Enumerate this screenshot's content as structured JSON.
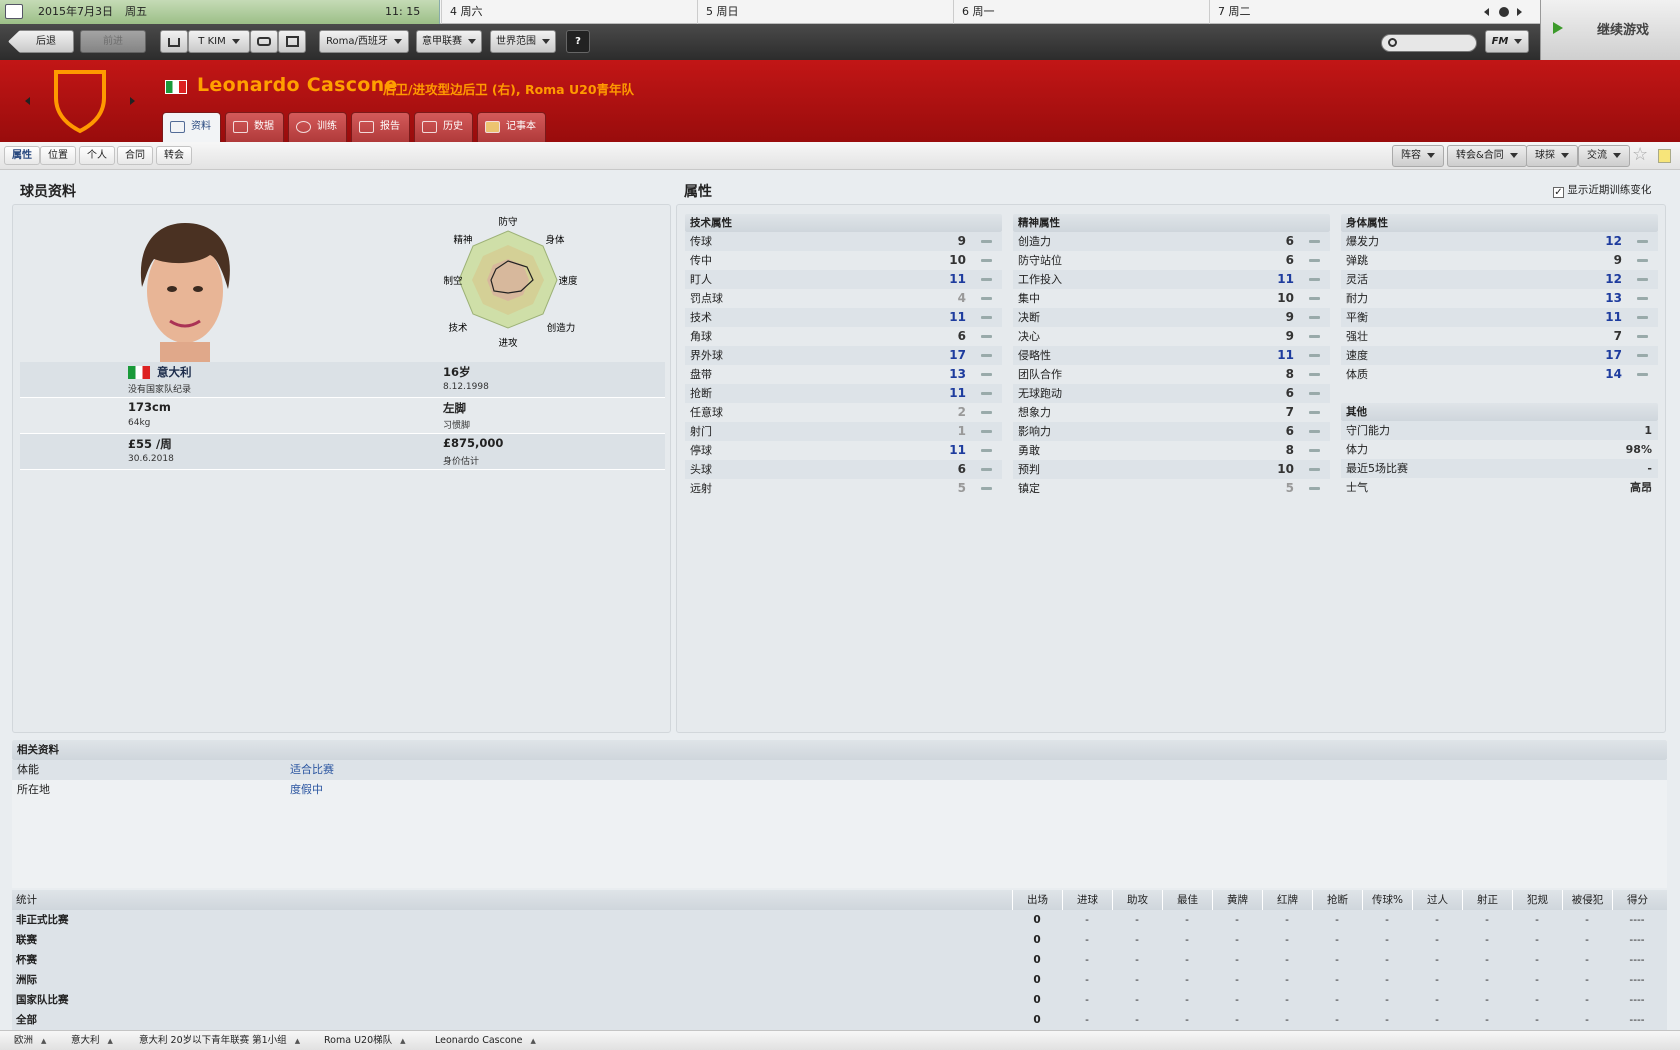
{
  "calendar": {
    "date": "2015年7月3日",
    "weekday": "周五",
    "time": "11: 15",
    "days": [
      "4 周六",
      "5 周日",
      "6 周一",
      "7 周二"
    ]
  },
  "nav": {
    "back": "后退",
    "forward": "前进",
    "manager": "T KIM",
    "team": "Roma/西班牙",
    "league": "意甲联赛",
    "world": "世界范围",
    "help": "?",
    "fm": "FM",
    "continue": "继续游戏"
  },
  "player": {
    "name": "Leonardo Cascone",
    "position": "后卫/进攻型边后卫 (右), Roma U20青年队"
  },
  "tabs": [
    "资料",
    "数据",
    "训练",
    "报告",
    "历史",
    "记事本"
  ],
  "subtabs": [
    "属性",
    "位置",
    "个人",
    "合同",
    "转会"
  ],
  "right_actions": [
    "阵容",
    "转会&合同",
    "球探",
    "交流"
  ],
  "profile": {
    "title": "球员资料",
    "radar_labels": [
      "防守",
      "身体",
      "速度",
      "创造力",
      "进攻",
      "技术",
      "制空",
      "精神"
    ],
    "nation": "意大利",
    "caps": "没有国家队纪录",
    "age": "16岁",
    "dob": "8.12.1998",
    "height": "173cm",
    "weight": "64kg",
    "foot": "左脚",
    "foot_label": "习惯脚",
    "wage": "£55 /周",
    "contract": "30.6.2018",
    "value": "£875,000",
    "value_label": "身价估计"
  },
  "attributes": {
    "title": "属性",
    "show_training": "显示近期训练变化",
    "technical": {
      "title": "技术属性",
      "rows": [
        [
          "传球",
          "9"
        ],
        [
          "传中",
          "10"
        ],
        [
          "盯人",
          "11"
        ],
        [
          "罚点球",
          "4"
        ],
        [
          "技术",
          "11"
        ],
        [
          "角球",
          "6"
        ],
        [
          "界外球",
          "17"
        ],
        [
          "盘带",
          "13"
        ],
        [
          "抢断",
          "11"
        ],
        [
          "任意球",
          "2"
        ],
        [
          "射门",
          "1"
        ],
        [
          "停球",
          "11"
        ],
        [
          "头球",
          "6"
        ],
        [
          "远射",
          "5"
        ]
      ]
    },
    "mental": {
      "title": "精神属性",
      "rows": [
        [
          "创造力",
          "6"
        ],
        [
          "防守站位",
          "6"
        ],
        [
          "工作投入",
          "11"
        ],
        [
          "集中",
          "10"
        ],
        [
          "决断",
          "9"
        ],
        [
          "决心",
          "9"
        ],
        [
          "侵略性",
          "11"
        ],
        [
          "团队合作",
          "8"
        ],
        [
          "无球跑动",
          "6"
        ],
        [
          "想象力",
          "7"
        ],
        [
          "影响力",
          "6"
        ],
        [
          "勇敢",
          "8"
        ],
        [
          "预判",
          "10"
        ],
        [
          "镇定",
          "5"
        ]
      ]
    },
    "physical": {
      "title": "身体属性",
      "rows": [
        [
          "爆发力",
          "12"
        ],
        [
          "弹跳",
          "9"
        ],
        [
          "灵活",
          "12"
        ],
        [
          "耐力",
          "13"
        ],
        [
          "平衡",
          "11"
        ],
        [
          "强壮",
          "7"
        ],
        [
          "速度",
          "17"
        ],
        [
          "体质",
          "14"
        ]
      ]
    },
    "other": {
      "title": "其他",
      "rows": [
        [
          "守门能力",
          "1"
        ],
        [
          "体力",
          "98%"
        ],
        [
          "最近5场比赛",
          "-"
        ],
        [
          "士气",
          "高昂"
        ]
      ]
    }
  },
  "related": {
    "title": "相关资料",
    "rows": [
      [
        "体能",
        "适合比赛"
      ],
      [
        "所在地",
        "度假中"
      ]
    ]
  },
  "stats": {
    "headers": [
      "统计",
      "出场",
      "进球",
      "助攻",
      "最佳",
      "黄牌",
      "红牌",
      "抢断",
      "传球%",
      "过人",
      "射正",
      "犯规",
      "被侵犯",
      "得分"
    ],
    "rows": [
      [
        "非正式比赛",
        "0",
        "-",
        "-",
        "-",
        "-",
        "-",
        "-",
        "-",
        "-",
        "-",
        "-",
        "-",
        "----"
      ],
      [
        "联赛",
        "0",
        "-",
        "-",
        "-",
        "-",
        "-",
        "-",
        "-",
        "-",
        "-",
        "-",
        "-",
        "----"
      ],
      [
        "杯赛",
        "0",
        "-",
        "-",
        "-",
        "-",
        "-",
        "-",
        "-",
        "-",
        "-",
        "-",
        "-",
        "----"
      ],
      [
        "洲际",
        "0",
        "-",
        "-",
        "-",
        "-",
        "-",
        "-",
        "-",
        "-",
        "-",
        "-",
        "-",
        "----"
      ],
      [
        "国家队比赛",
        "0",
        "-",
        "-",
        "-",
        "-",
        "-",
        "-",
        "-",
        "-",
        "-",
        "-",
        "-",
        "----"
      ],
      [
        "全部",
        "0",
        "-",
        "-",
        "-",
        "-",
        "-",
        "-",
        "-",
        "-",
        "-",
        "-",
        "-",
        "----"
      ]
    ]
  },
  "breadcrumb": [
    "欧洲",
    "意大利",
    "意大利 20岁以下青年联赛 第1小组",
    "Roma U20梯队",
    "Leonardo Cascone"
  ],
  "colors": {
    "header_red": "#b01010",
    "name_orange": "#ff9900",
    "value_blue": "#1e3c9e"
  },
  "icons": [
    "calendar-icon",
    "home-icon",
    "search-icon",
    "star-icon",
    "note-add-icon",
    "shield-crest-icon",
    "italy-flag-icon"
  ]
}
